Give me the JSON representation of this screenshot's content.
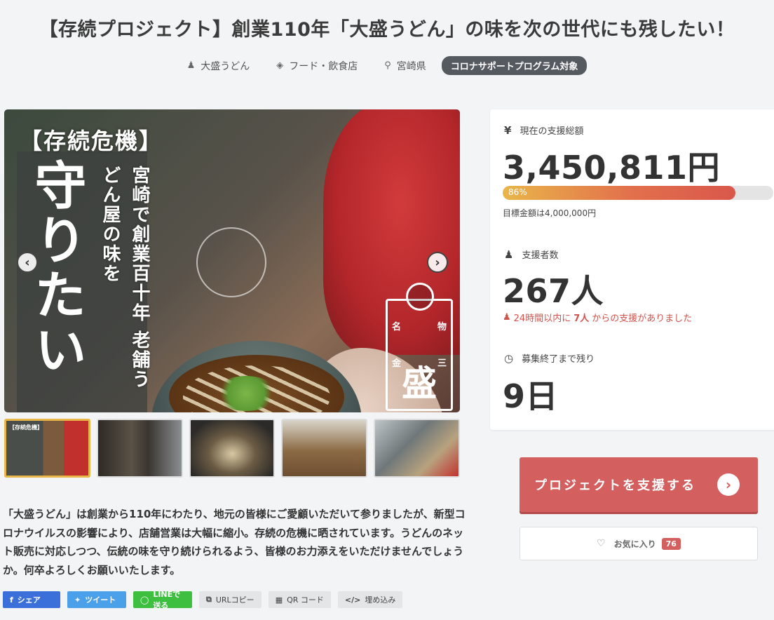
{
  "project": {
    "title": "【存続プロジェクト】創業110年「大盛うどん」の味を次の世代にも残したい！",
    "owner": "大盛うどん",
    "category": "フード・飲食店",
    "location": "宮崎県",
    "program_badge": "コロナサポートプログラム対象"
  },
  "hero": {
    "headline": "【存続危機】",
    "big_text": "守りたい",
    "sub_text": "宮崎で創業百十年 老舗うどん屋の味を",
    "seal_char": "盛",
    "seal_left": "金",
    "seal_right": "三",
    "seal_top_left": "名",
    "seal_top_right": "物",
    "thumb1_label": "【存続危機】"
  },
  "description": "「大盛うどん」は創業から110年にわたり、地元の皆様にご愛顧いただいて参りましたが、新型コロナウイルスの影響により、店舗営業は大幅に縮小。存続の危機に晒されています。うどんのネット販売に対応しつつ、伝統の味を守り続けられるよう、皆様のお力添えをいただけませんでしょうか。何卒よろしくお願いいたします。",
  "share": {
    "facebook": "シェア",
    "twitter": "ツイート",
    "line": "LINEで送る",
    "url_copy": "URLコピー",
    "qr": "QR コード",
    "embed": "埋め込み"
  },
  "stats": {
    "total_label": "現在の支援総額",
    "total_amount": "3,450,811円",
    "progress_percent": 86,
    "progress_label": "86%",
    "goal": "目標金額は4,000,000円",
    "supporters_label": "支援者数",
    "supporters": "267人",
    "recent_prefix": "24時間以内に",
    "recent_count": "7人",
    "recent_suffix": "からの支援がありました",
    "remaining_label": "募集終了まで残り",
    "remaining": "9日"
  },
  "actions": {
    "support_label": "プロジェクトを支援する",
    "favorite_label": "お気に入り",
    "favorite_count": "76"
  },
  "colors": {
    "accent": "#d45f5f",
    "progress_start": "#e9b64a",
    "progress_end": "#d9574b",
    "badge_bg": "#555a60"
  }
}
